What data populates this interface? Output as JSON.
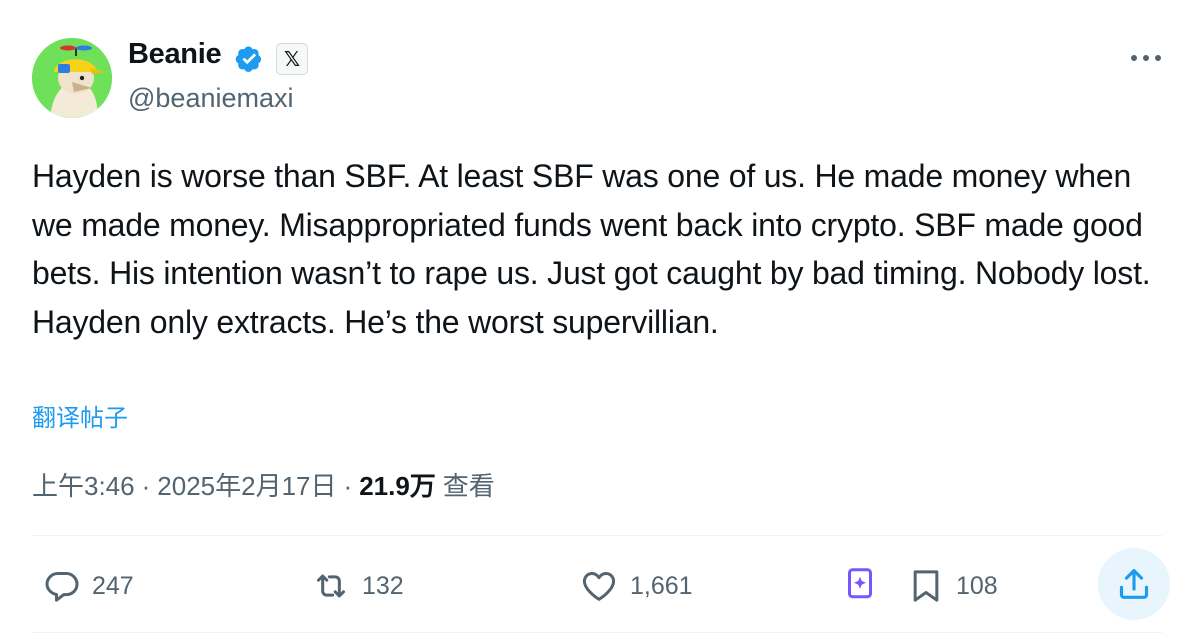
{
  "author": {
    "name": "Beanie",
    "handle": "@beaniemaxi",
    "verified_icon": "verified-badge-icon",
    "affiliation_icon": "x-affiliation-icon",
    "affiliation_glyph": "𝕏"
  },
  "tweet": {
    "text": "Hayden is worse than SBF. At least SBF was one of us. He made money when we made money. Misappropriated funds went back into crypto. SBF made good bets. His intention wasn’t to rape us. Just got caught by bad timing. Nobody lost. Hayden only extracts. He’s the worst supervillian.",
    "translate_label": "翻译帖子"
  },
  "meta": {
    "time": "上午3:46",
    "separator": "·",
    "date": "2025年2月17日",
    "views_count": "21.9万",
    "views_label": "查看"
  },
  "actions": {
    "replies": "247",
    "retweets": "132",
    "likes": "1,661",
    "bookmarks": "108"
  },
  "colors": {
    "accent": "#1d9bf0",
    "secondary_text": "#536471",
    "grok_purple": "#7856ff"
  }
}
